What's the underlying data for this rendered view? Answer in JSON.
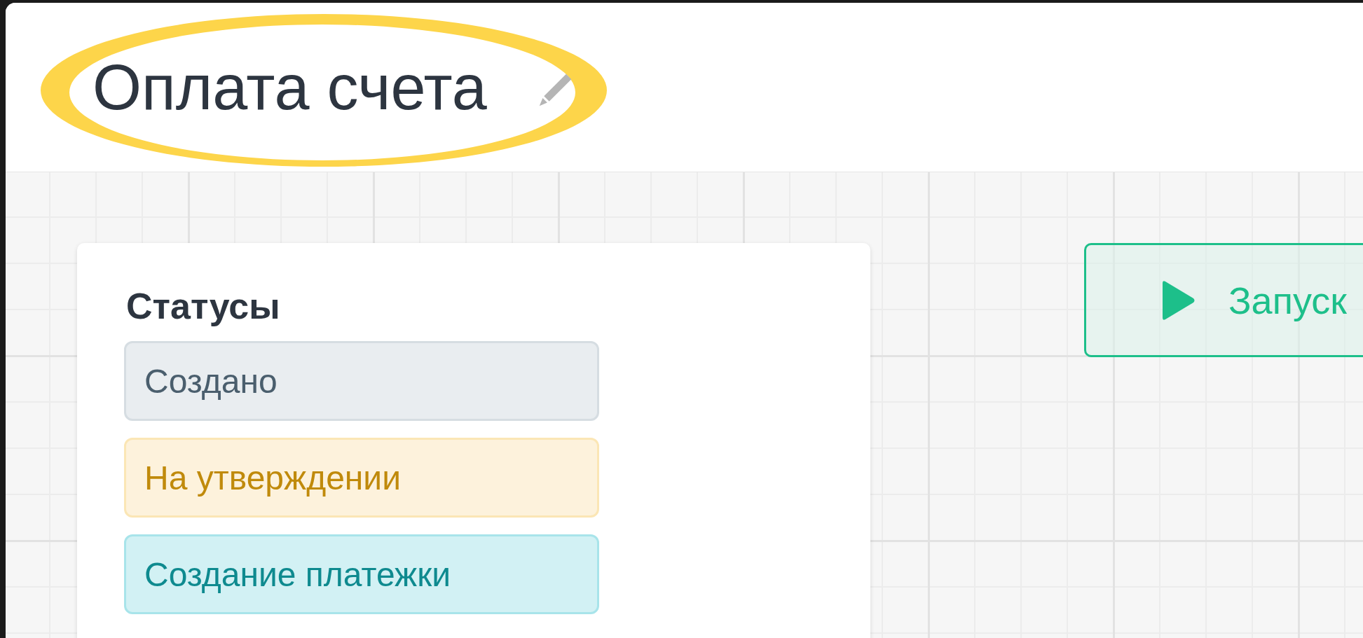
{
  "header": {
    "title": "Оплата счета"
  },
  "statuses_panel": {
    "heading": "Статусы",
    "statuses": [
      {
        "label": "Создано",
        "kind": "secondary"
      },
      {
        "label": "На утверждении",
        "kind": "warning"
      },
      {
        "label": "Создание платежки",
        "kind": "info"
      }
    ]
  },
  "run_button": {
    "label": "Запуск"
  }
}
